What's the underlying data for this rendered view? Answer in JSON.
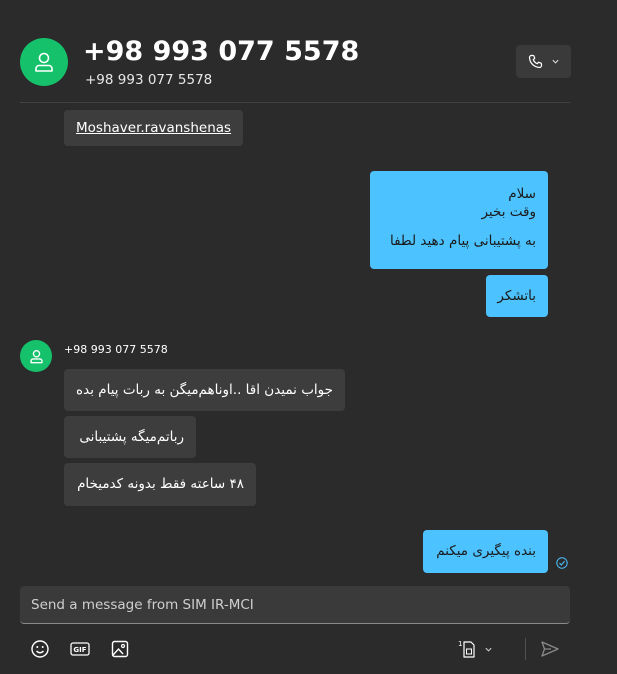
{
  "header": {
    "title": "+98 993 077 5578",
    "subtitle": "+98 993 077 5578",
    "avatar_icon": "person-icon",
    "call_icon": "phone-icon",
    "dropdown_icon": "chevron-down-icon"
  },
  "messages": {
    "link_text": "Moshaver.ravanshenas",
    "out1": {
      "line1": "سلام",
      "line2": "وقت بخیر",
      "line3": "به پشتیبانی پیام دهید لطفا"
    },
    "out2": "باتشکر",
    "sender_name": "+98 993 077 5578",
    "in1": "جواب نمیدن اقا ..اوناهم‌میگن به ربات پیام بده",
    "in2": "رباتم‌میگه پشتیبانی",
    "in3": "۴۸ ساعته فقط بدونه کدمیخام",
    "out3": "بنده پیگیری میکنم",
    "status_icon": "sent-check-icon"
  },
  "compose": {
    "placeholder": "Send a message from SIM IR-MCI",
    "value": ""
  },
  "toolbar": {
    "sim_number": "1",
    "icons": [
      "emoji-icon",
      "gif-icon",
      "image-icon",
      "sim-card-icon",
      "send-icon"
    ]
  },
  "colors": {
    "background": "#2b2b2b",
    "incoming_bubble": "#3d3d3d",
    "outgoing_bubble": "#4cc2ff",
    "avatar": "#15c26b"
  }
}
